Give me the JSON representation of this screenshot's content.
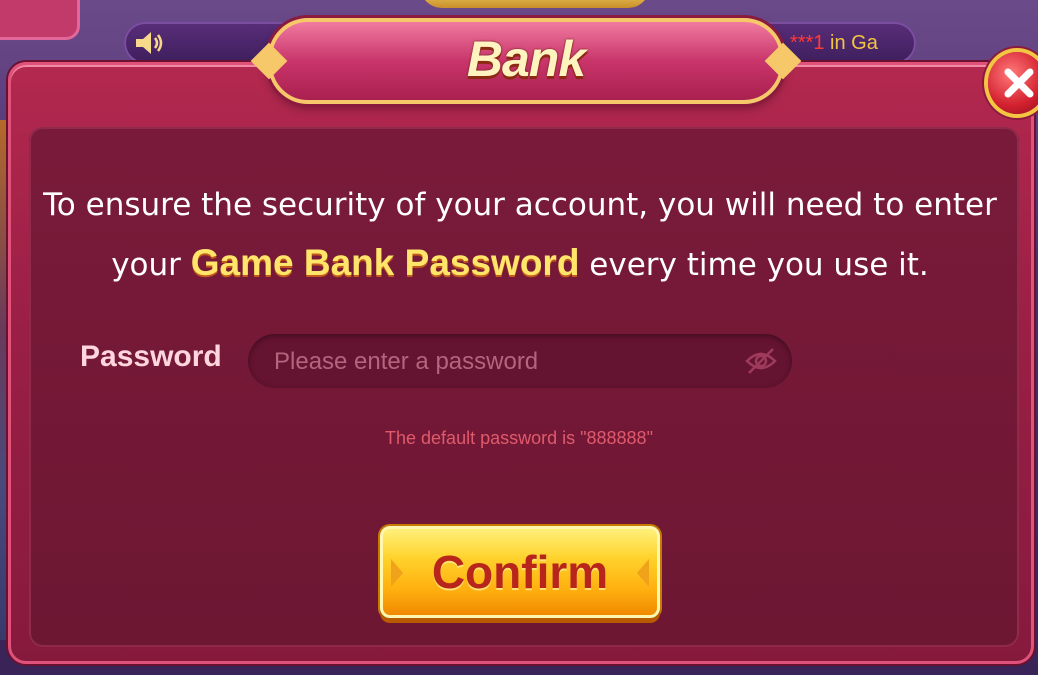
{
  "marquee": {
    "masked_prefix": "***1",
    "text": " in Ga"
  },
  "dialog": {
    "title": "Bank",
    "message_part1": "To ensure the security of your account, you will need to enter your ",
    "message_highlight": "Game Bank Password",
    "message_part2": " every time you use it.",
    "password_label": "Password",
    "password_placeholder": "Please enter a password",
    "password_value": "",
    "hint": "The default password is \"888888\"",
    "confirm_label": "Confirm"
  },
  "icons": {
    "speaker": "speaker-icon",
    "close": "close-icon",
    "eye_hidden": "eye-off-icon"
  },
  "colors": {
    "dialog_bg": "#9a1f45",
    "highlight": "#ffe66a",
    "confirm_button": "#ffc21a",
    "hint": "#e05a6c"
  }
}
